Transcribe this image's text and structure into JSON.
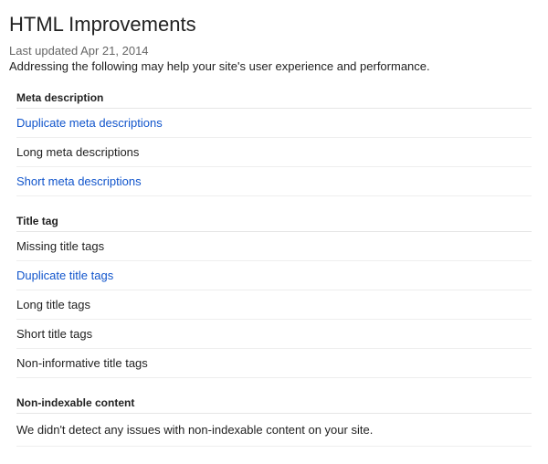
{
  "title": "HTML Improvements",
  "lastUpdatedLabel": "Last updated",
  "lastUpdatedDate": "Apr 21, 2014",
  "intro": "Addressing the following may help your site's user experience and performance.",
  "sections": {
    "meta": {
      "header": "Meta description",
      "items": [
        {
          "label": "Duplicate meta descriptions",
          "link": true
        },
        {
          "label": "Long meta descriptions",
          "link": false
        },
        {
          "label": "Short meta descriptions",
          "link": true
        }
      ]
    },
    "title": {
      "header": "Title tag",
      "items": [
        {
          "label": "Missing title tags",
          "link": false
        },
        {
          "label": "Duplicate title tags",
          "link": true
        },
        {
          "label": "Long title tags",
          "link": false
        },
        {
          "label": "Short title tags",
          "link": false
        },
        {
          "label": "Non-informative title tags",
          "link": false
        }
      ]
    },
    "nonindex": {
      "header": "Non-indexable content",
      "note": "We didn't detect any issues with non-indexable content on your site."
    }
  }
}
